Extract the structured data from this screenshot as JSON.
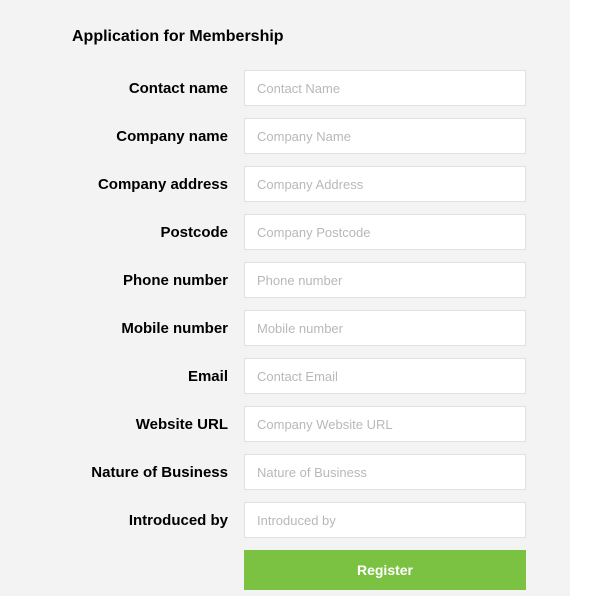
{
  "form": {
    "title": "Application for Membership",
    "fields": [
      {
        "label": "Contact name",
        "placeholder": "Contact Name",
        "value": ""
      },
      {
        "label": "Company name",
        "placeholder": "Company Name",
        "value": ""
      },
      {
        "label": "Company address",
        "placeholder": "Company Address",
        "value": ""
      },
      {
        "label": "Postcode",
        "placeholder": "Company Postcode",
        "value": ""
      },
      {
        "label": "Phone number",
        "placeholder": "Phone number",
        "value": ""
      },
      {
        "label": "Mobile number",
        "placeholder": "Mobile number",
        "value": ""
      },
      {
        "label": "Email",
        "placeholder": "Contact Email",
        "value": ""
      },
      {
        "label": "Website URL",
        "placeholder": "Company Website URL",
        "value": ""
      },
      {
        "label": "Nature of Business",
        "placeholder": "Nature of Business",
        "value": ""
      },
      {
        "label": "Introduced by",
        "placeholder": "Introduced by",
        "value": ""
      }
    ],
    "submit_label": "Register"
  }
}
